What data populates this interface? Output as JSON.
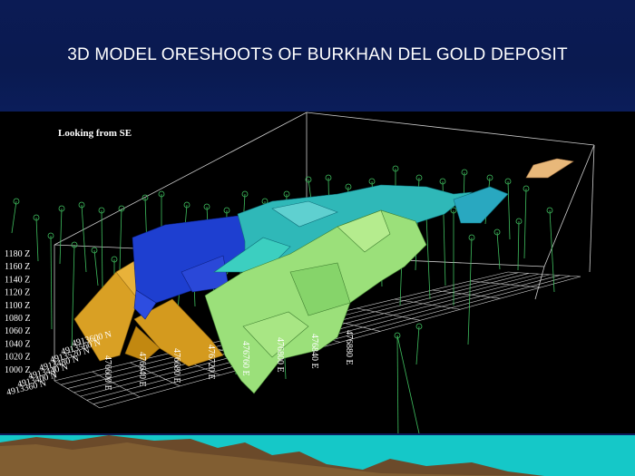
{
  "slide": {
    "title": "3D MODEL ORESHOOTS OF BURKHAN DEL GOLD DEPOSIT",
    "view_label": "Looking from SE"
  },
  "elevation_labels": [
    "1180 Z",
    "1160 Z",
    "1140 Z",
    "1120 Z",
    "1100 Z",
    "1080 Z",
    "1060 Z",
    "1040 Z",
    "1020 Z",
    "1000 Z"
  ],
  "northing_labels": [
    "4913600 N",
    "4913560 N",
    "4913520 N",
    "4913480 N",
    "4913440 N",
    "4913400 N",
    "4913360 N"
  ],
  "easting_labels": [
    "476600 E",
    "476640 E",
    "476680 E",
    "476720 E",
    "476760 E",
    "476800 E",
    "476840 E",
    "476880 E"
  ],
  "colors": {
    "header": "#0b1b54",
    "grid": "#cfcfcf",
    "drillhole": "#3fbf5f",
    "oreshoot_orange": "#d9a024",
    "oreshoot_blue": "#1e3fd0",
    "oreshoot_cyan": "#2fb8b8",
    "oreshoot_green": "#9be07a",
    "footer_sea": "#15c8c8",
    "footer_mountain": "#6b4a2a"
  }
}
